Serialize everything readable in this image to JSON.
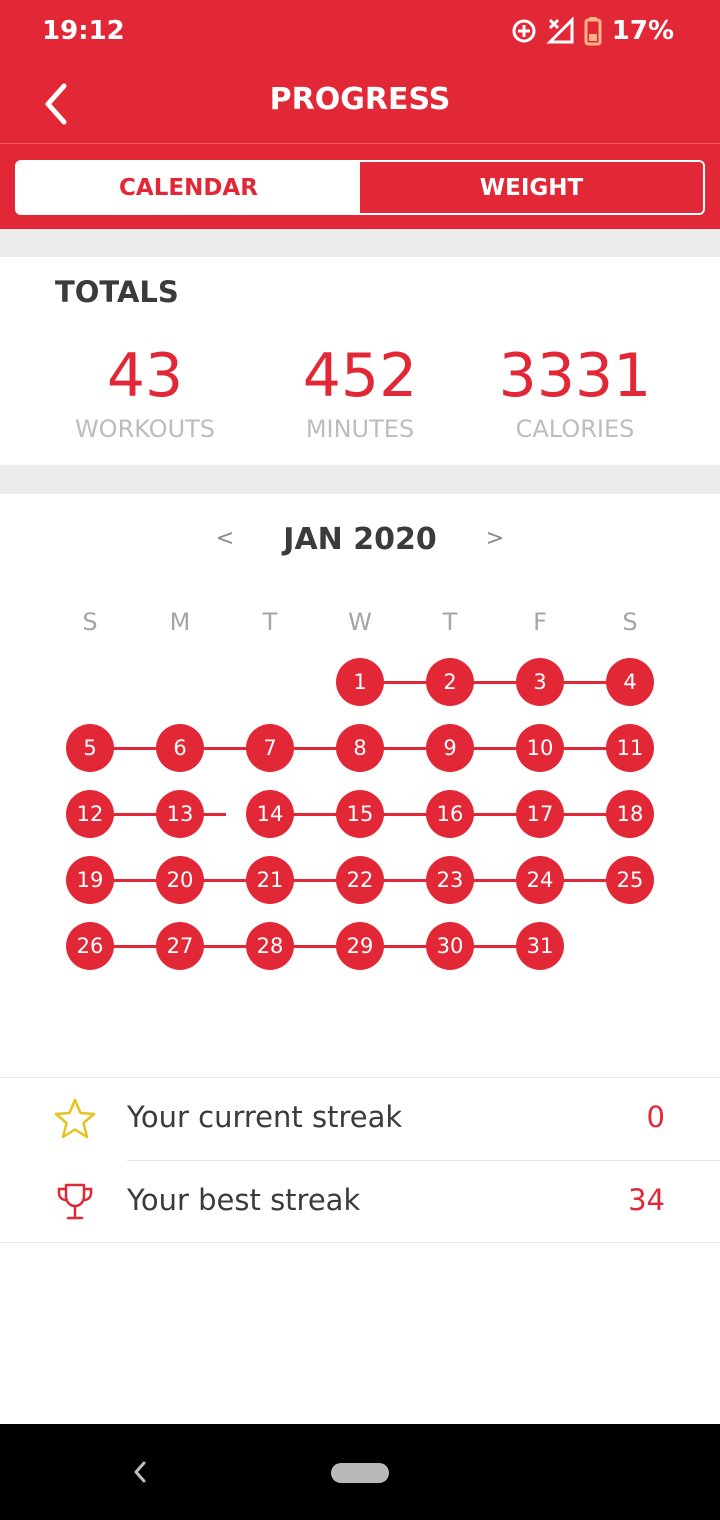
{
  "status_bar": {
    "time": "19:12",
    "battery": "17%",
    "icons": [
      "data-saver-icon",
      "no-signal-icon",
      "battery-low-icon"
    ]
  },
  "appbar": {
    "title": "PROGRESS",
    "back_icon": "chevron-left-icon"
  },
  "tabs": [
    {
      "label": "CALENDAR",
      "active": true
    },
    {
      "label": "WEIGHT",
      "active": false
    }
  ],
  "totals": {
    "title": "TOTALS",
    "stats": [
      {
        "value": "43",
        "label": "WORKOUTS"
      },
      {
        "value": "452",
        "label": "MINUTES"
      },
      {
        "value": "3331",
        "label": "CALORIES"
      }
    ]
  },
  "calendar": {
    "month": "JAN 2020",
    "prev_label": "<",
    "next_label": ">",
    "weekdays": [
      "S",
      "M",
      "T",
      "W",
      "T",
      "F",
      "S"
    ],
    "first_weekday_index": 3,
    "days_in_month": 31,
    "workout_days": [
      1,
      2,
      3,
      4,
      5,
      6,
      7,
      8,
      9,
      10,
      11,
      12,
      13,
      14,
      15,
      16,
      17,
      18,
      19,
      20,
      21,
      22,
      23,
      24,
      25,
      26,
      27,
      28,
      29,
      30,
      31
    ],
    "streak_break_after": 13
  },
  "streaks": [
    {
      "icon": "star-icon",
      "label": "Your current streak",
      "value": "0"
    },
    {
      "icon": "trophy-icon",
      "label": "Your best streak",
      "value": "34"
    }
  ],
  "colors": {
    "primary": "#e22836",
    "text_dark": "#3b3b3b",
    "text_muted": "#bdbdbd",
    "band": "#ececec",
    "star": "#e8c21a"
  }
}
